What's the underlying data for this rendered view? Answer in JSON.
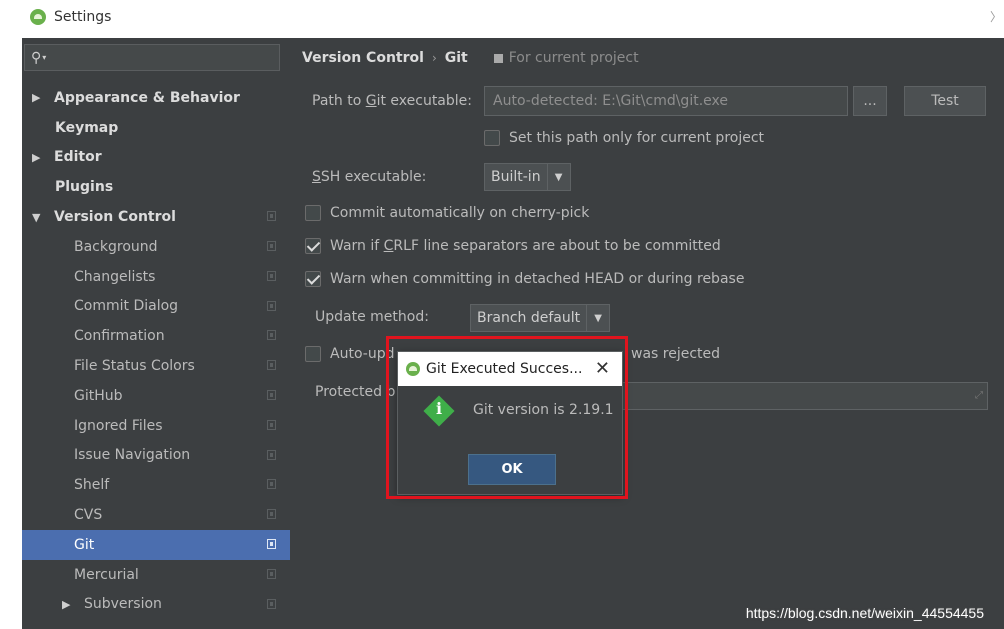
{
  "window": {
    "title": "Settings"
  },
  "search": {
    "icon": "search-icon"
  },
  "sidebar": {
    "items": [
      {
        "label": "Appearance & Behavior",
        "arrow": "▶",
        "bold": true
      },
      {
        "label": "Keymap",
        "bold": true
      },
      {
        "label": "Editor",
        "arrow": "▶",
        "bold": true
      },
      {
        "label": "Plugins",
        "bold": true
      },
      {
        "label": "Version Control",
        "arrow": "▼",
        "bold": true
      },
      {
        "label": "Background"
      },
      {
        "label": "Changelists"
      },
      {
        "label": "Commit Dialog"
      },
      {
        "label": "Confirmation"
      },
      {
        "label": "File Status Colors"
      },
      {
        "label": "GitHub"
      },
      {
        "label": "Ignored Files"
      },
      {
        "label": "Issue Navigation"
      },
      {
        "label": "Shelf"
      },
      {
        "label": "CVS"
      },
      {
        "label": "Git",
        "selected": true
      },
      {
        "label": "Mercurial"
      },
      {
        "label": "Subversion",
        "arrow": "▶"
      }
    ]
  },
  "breadcrumb": {
    "part1": "Version Control",
    "separator": "›",
    "part2": "Git",
    "scope_label": "For current project"
  },
  "git": {
    "path_label_pre": "Path to ",
    "path_label_u": "G",
    "path_label_post": "it executable:",
    "path_value": "Auto-detected: E:\\Git\\cmd\\git.exe",
    "browse_label": "...",
    "test_label": "Test",
    "this_project_only_label": "Set this path only for current project",
    "ssh_label_u": "S",
    "ssh_label_post": "SH executable:",
    "ssh_value": "Built-in",
    "commit_cherry_label": "Commit automatically on cherry-pick",
    "crlf_label_pre": "Warn if ",
    "crlf_label_u": "C",
    "crlf_label_post": "RLF line separators are about to be committed",
    "detached_label": "Warn when committing in detached HEAD or during rebase",
    "update_method_label": "Update method:",
    "update_method_value": "Branch default",
    "auto_update_label_pre": "Auto-upd",
    "auto_update_label_post": "was rejected",
    "protected_label": "Protected b"
  },
  "dialog": {
    "title": "Git Executed Succes...",
    "close": "✕",
    "message": "Git version is 2.19.1",
    "ok_label": "OK",
    "icon": "info-icon"
  },
  "watermark": "https://blog.csdn.net/weixin_44554455"
}
